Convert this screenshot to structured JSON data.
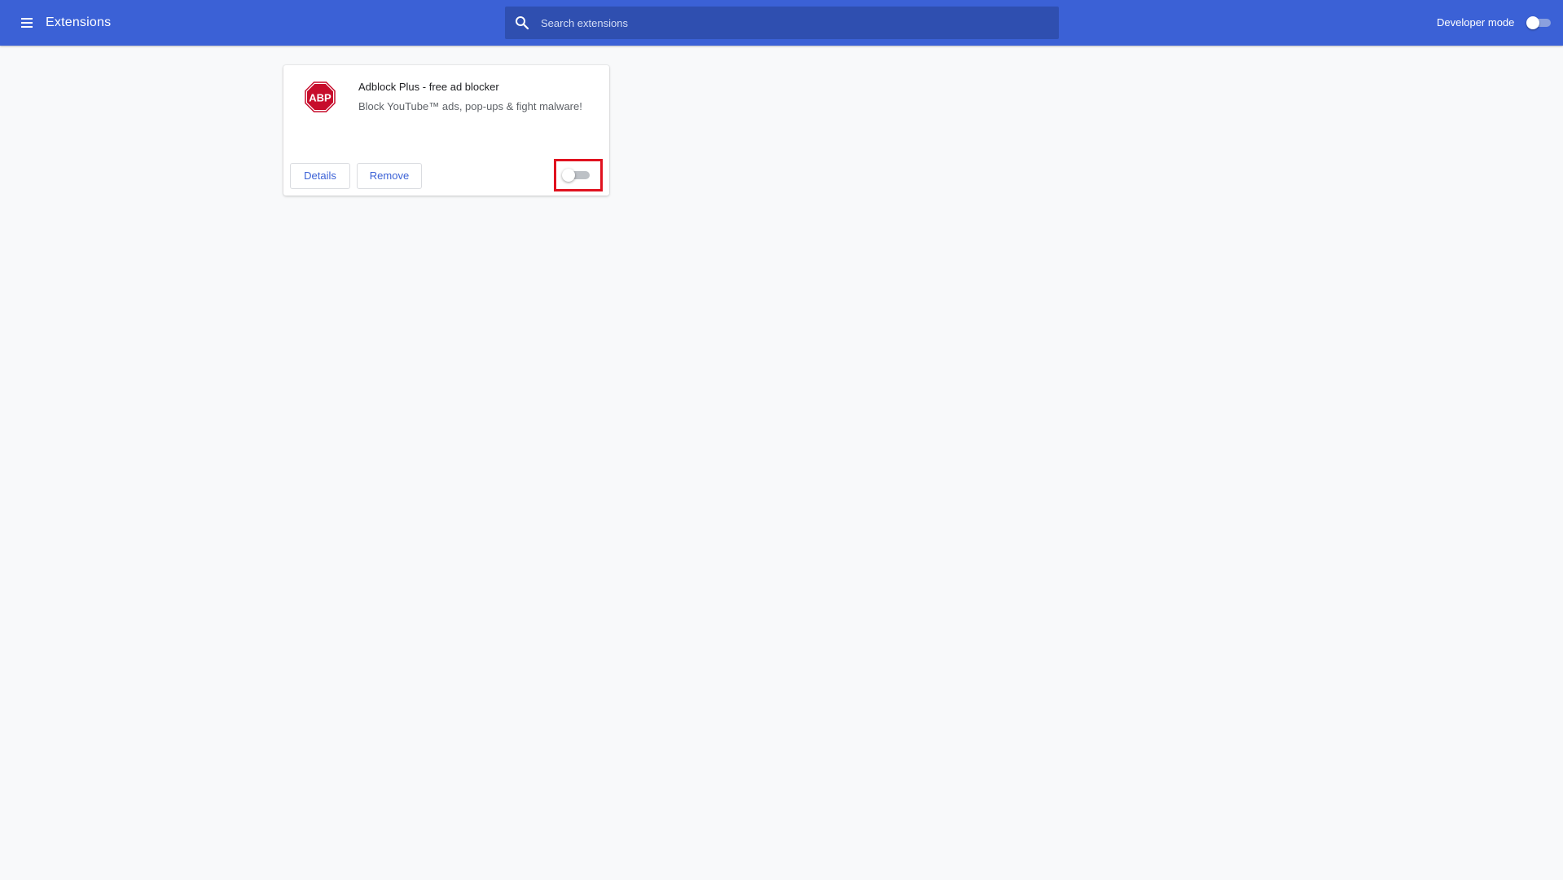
{
  "header": {
    "title": "Extensions",
    "menu_icon": "hamburger-menu-icon",
    "search": {
      "icon": "search-icon",
      "placeholder": "Search extensions",
      "value": ""
    },
    "developer_mode": {
      "label": "Developer mode",
      "enabled": false
    }
  },
  "extensions": [
    {
      "icon": "adblock-plus-icon",
      "icon_text": "ABP",
      "name": "Adblock Plus - free ad blocker",
      "description": "Block YouTube™ ads, pop-ups & fight malware!",
      "details_label": "Details",
      "remove_label": "Remove",
      "enabled": false,
      "toggle_highlighted": true
    }
  ],
  "colors": {
    "header_bg": "#3b61d6",
    "search_bg": "#2f4fb0",
    "page_bg": "#f8f9fa",
    "accent_text": "#3b61d6",
    "highlight": "#e0121f",
    "abp_red": "#c70d2c"
  }
}
